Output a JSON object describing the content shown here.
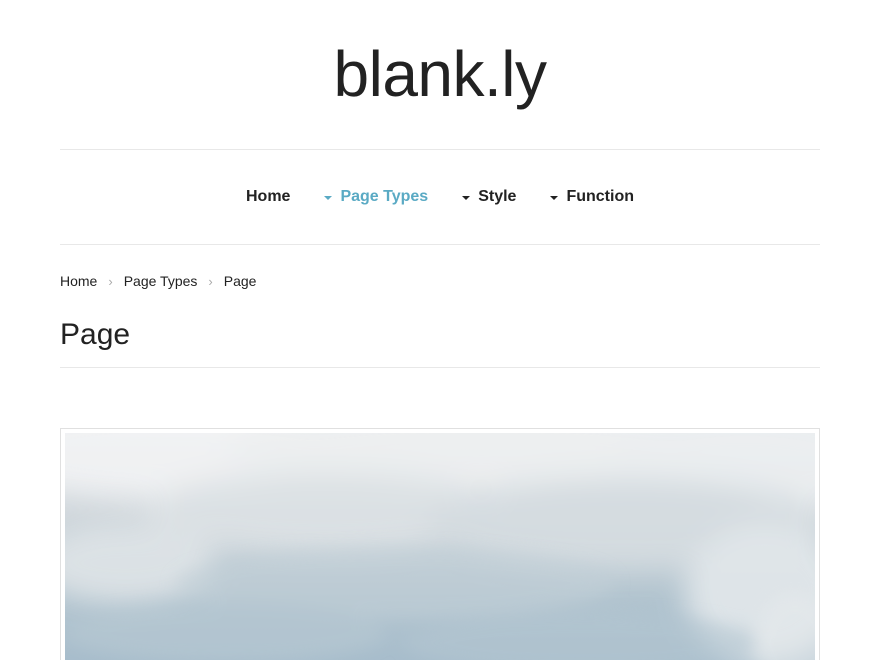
{
  "site": {
    "title": "blank.ly"
  },
  "nav": {
    "items": [
      {
        "label": "Home",
        "has_dropdown": false,
        "active": false
      },
      {
        "label": "Page Types",
        "has_dropdown": true,
        "active": true
      },
      {
        "label": "Style",
        "has_dropdown": true,
        "active": false
      },
      {
        "label": "Function",
        "has_dropdown": true,
        "active": false
      }
    ]
  },
  "breadcrumb": {
    "items": [
      "Home",
      "Page Types",
      "Page"
    ],
    "separator": "›"
  },
  "page": {
    "title": "Page"
  },
  "colors": {
    "accent": "#5aaac4",
    "text": "#222222",
    "rule": "#e8e8e8"
  }
}
